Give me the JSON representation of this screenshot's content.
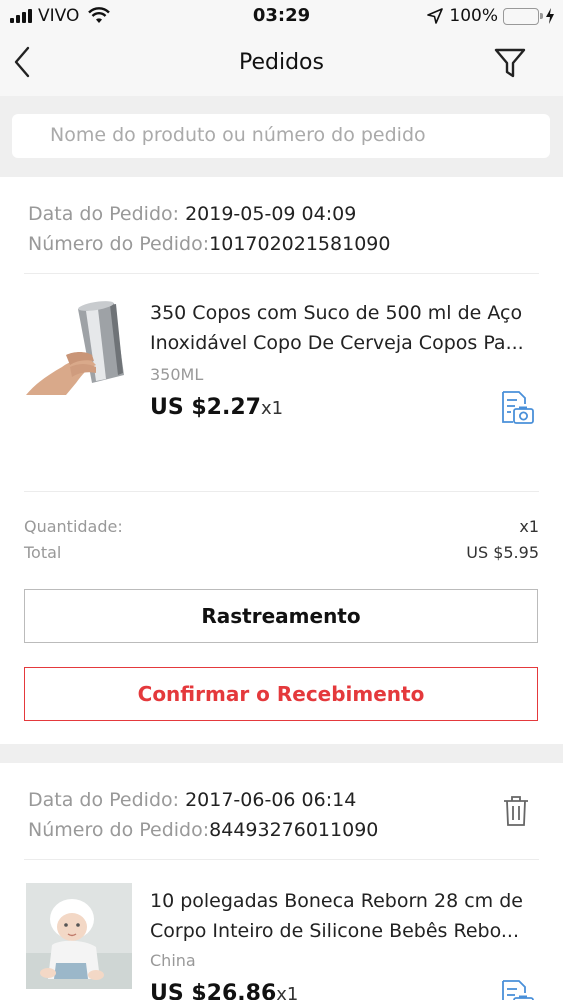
{
  "status_bar": {
    "carrier": "VIVO",
    "time": "03:29",
    "battery": "100%"
  },
  "nav": {
    "title": "Pedidos"
  },
  "search": {
    "placeholder": "Nome do produto ou número do pedido"
  },
  "orders": [
    {
      "date_label": "Data do Pedido:",
      "date": "2019-05-09 04:09",
      "number_label": "Número do Pedido:",
      "number": "101702021581090",
      "product": {
        "name_line1": "350 Copos com Suco de 500 ml de Aço",
        "name_line2": "Inoxidável Copo De Cerveja Copos Pa...",
        "variant": "350ML",
        "price": "US $2.27",
        "qty": "x1"
      },
      "quantity_label": "Quantidade:",
      "quantity": "x1",
      "total_label": "Total",
      "total": "US $5.95",
      "tracking_button": "Rastreamento",
      "confirm_button": "Confirmar o Recebimento"
    },
    {
      "date_label": "Data do Pedido:",
      "date": "2017-06-06 06:14",
      "number_label": "Número do Pedido:",
      "number": "84493276011090",
      "product": {
        "name_line1": "10 polegadas Boneca Reborn 28 cm de",
        "name_line2": "Corpo Inteiro de Silicone Bebês Rebo...",
        "variant": "China",
        "price": "US $26.86",
        "qty": "x1"
      }
    }
  ]
}
